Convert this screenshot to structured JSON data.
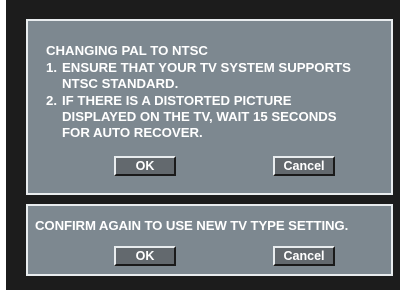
{
  "dialog1": {
    "title": "CHANGING PAL TO NTSC",
    "steps": [
      {
        "num": "1.",
        "lines": [
          "ENSURE THAT YOUR TV SYSTEM SUPPORTS",
          "NTSC STANDARD."
        ]
      },
      {
        "num": "2.",
        "lines": [
          "IF THERE IS A DISTORTED PICTURE",
          "DISPLAYED ON THE TV, WAIT 15 SECONDS",
          "FOR AUTO RECOVER."
        ]
      }
    ],
    "ok_label": "OK",
    "cancel_label": "Cancel"
  },
  "dialog2": {
    "message": "CONFIRM AGAIN TO USE NEW TV TYPE SETTING.",
    "ok_label": "OK",
    "cancel_label": "Cancel"
  },
  "colors": {
    "screen_background": "#1c1c1c",
    "dialog_background": "#7d8890",
    "dialog_border": "#e8ecee",
    "button_background": "#63696e",
    "text": "#ffffff"
  }
}
